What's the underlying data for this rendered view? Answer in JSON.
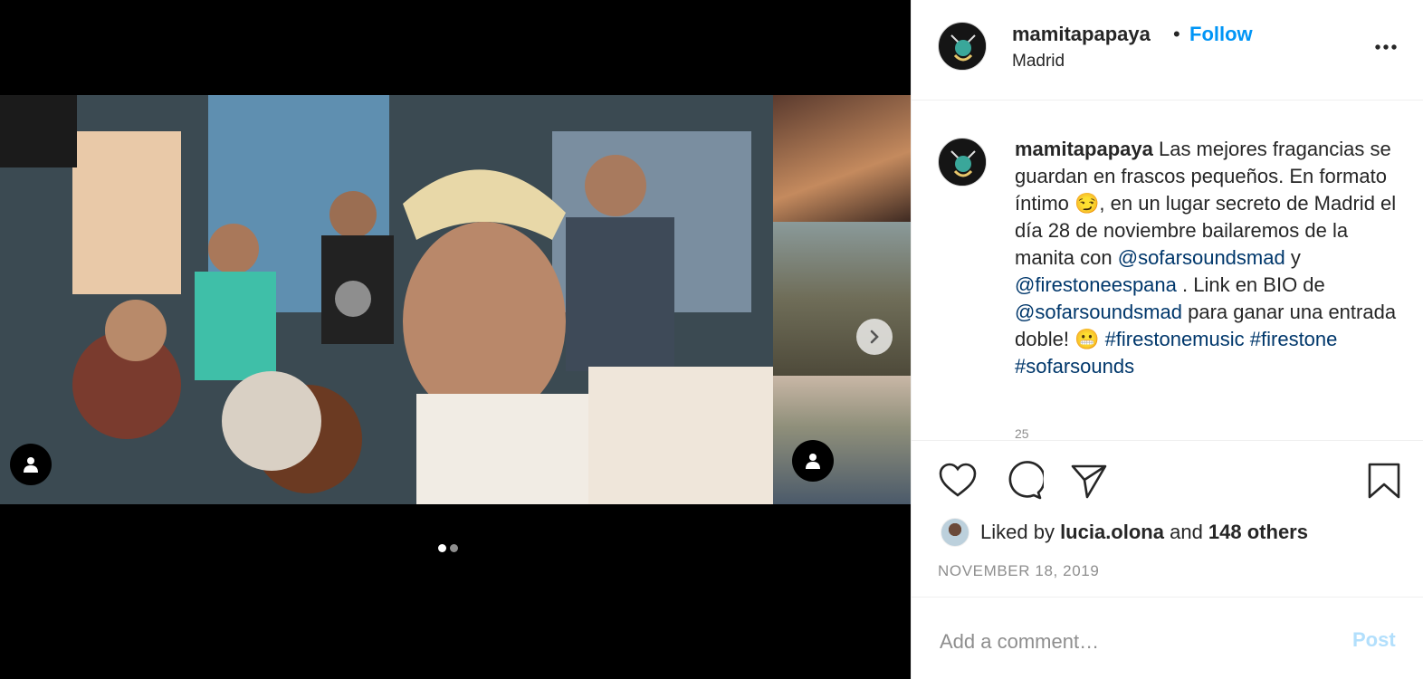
{
  "post": {
    "username": "mamitapapaya",
    "separator": "•",
    "follow_label": "Follow",
    "location": "Madrid",
    "caption_username": "mamitapapaya",
    "caption": [
      {
        "text": " Las mejores fragancias se guardan en frascos pequeños. En formato íntimo 😏, en un lugar secreto de Madrid el día 28 de noviembre bailaremos de la manita con "
      },
      {
        "link": "@sofarsoundsmad"
      },
      {
        "text": " y "
      },
      {
        "link": "@firestoneespana"
      },
      {
        "text": " . Link en BIO de "
      },
      {
        "link": "@sofarsoundsmad"
      },
      {
        "text": " para ganar una entrada doble! 😬 "
      },
      {
        "link": "#firestonemusic"
      },
      {
        "text": " "
      },
      {
        "link": "#firestone"
      },
      {
        "text": " "
      },
      {
        "link": "#sofarsounds"
      }
    ],
    "caption_meta": "25",
    "likes_prefix": "Liked by ",
    "liked_by_user": "lucia.olona",
    "likes_and": " and ",
    "likes_others": "148 others",
    "date": "NOVEMBER 18, 2019",
    "comment_placeholder": "Add a comment…",
    "post_button": "Post"
  },
  "carousel": {
    "total": 2,
    "active": 0
  },
  "icons": {
    "more": "more-options-icon",
    "like": "heart-icon",
    "comment": "comment-icon",
    "share": "paper-plane-icon",
    "save": "bookmark-icon",
    "next": "chevron-right-icon",
    "tag": "user-tag-icon"
  },
  "colors": {
    "link": "#00376b",
    "follow": "#0095f6",
    "muted": "#8e8e8e",
    "post_disabled": "#b2dffc"
  }
}
